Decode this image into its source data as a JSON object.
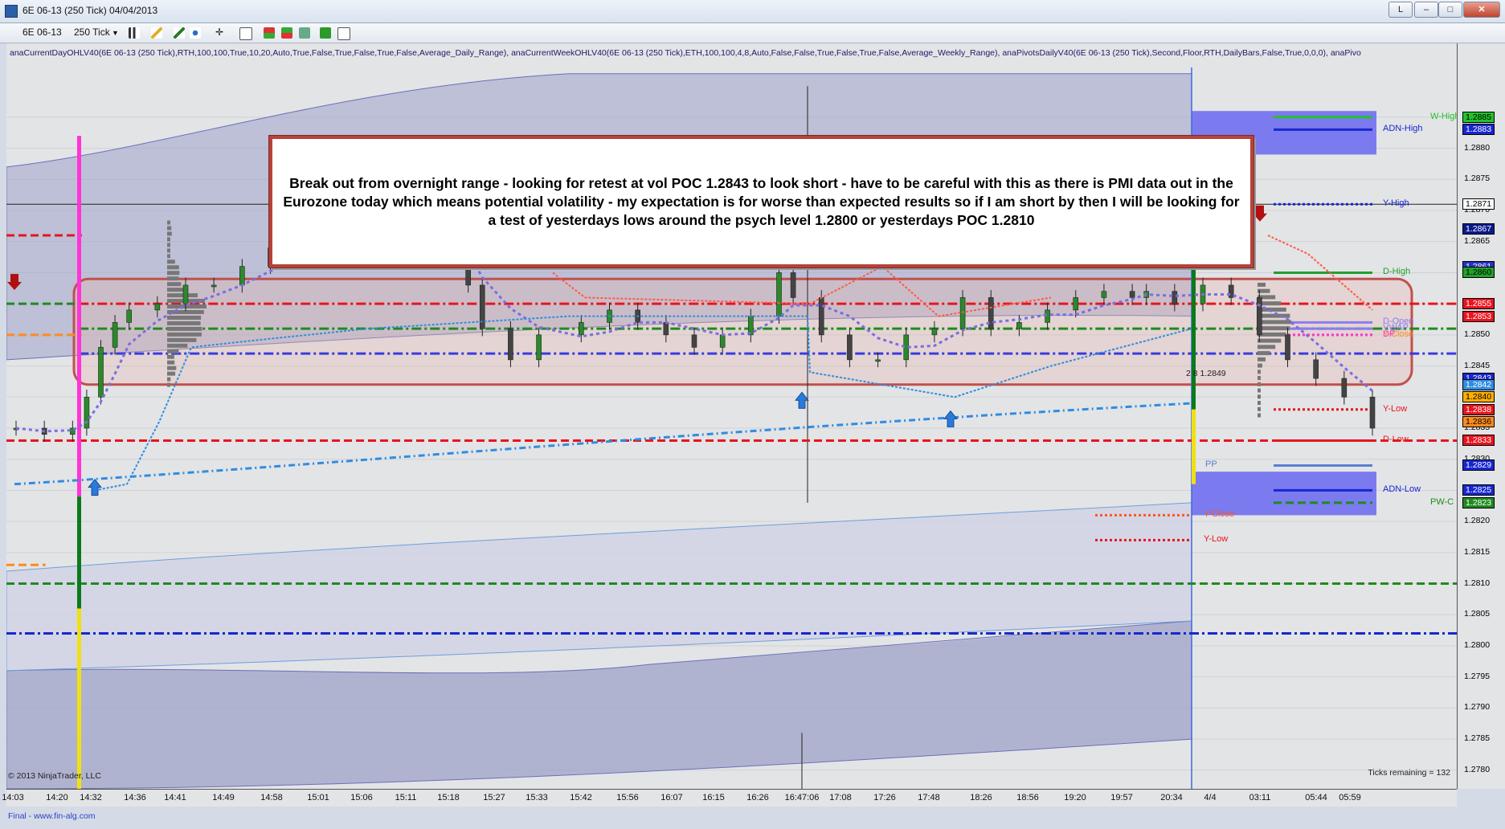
{
  "window": {
    "title": "6E 06-13 (250 Tick)  04/04/2013",
    "buttons": [
      "L",
      "–",
      "□",
      "✕"
    ]
  },
  "toolbar": {
    "instrument": "6E 06-13",
    "period": "250 Tick"
  },
  "indicators_line": "anaCurrentDayOHLV40(6E 06-13 (250 Tick),RTH,100,100,True,10,20,Auto,True,False,True,False,True,False,Average_Daily_Range), anaCurrentWeekOHLV40(6E 06-13 (250 Tick),ETH,100,100,4,8,Auto,False,False,True,False,True,False,Average_Weekly_Range), anaPivotsDailyV40(6E 06-13 (250 Tick),Second,Floor,RTH,DailyBars,False,True,0,0,0), anaPivo",
  "annotation": {
    "text": "Break out from overnight range - looking for retest at vol POC 1.2843 to look short - have to be careful with this as there is PMI data out in the Eurozone today which means potential volatility - my expectation is for worse than expected results so if I am short by then I will be looking for a test of yesterdays lows around the psych level 1.2800 or yesterdays POC 1.2810"
  },
  "copyright": "© 2013 NinjaTrader, LLC",
  "ticks_remaining": "Ticks remaining = 132",
  "footer_note": "Final - www.fin-alg.com",
  "mid_label": "2 8 1.2849",
  "colors": {
    "chart_bg": "#e3e4e6",
    "band": "#9fa3c8",
    "red": "#e8141e",
    "green": "#1f8a1f",
    "blue": "#1727d0",
    "orange": "#ff8a1e",
    "magenta": "#ff33d6",
    "lightblue": "#2f8de0",
    "purple": "#7a6ee0"
  },
  "chart_data": {
    "type": "line",
    "title": "6E 06-13 (250 Tick)",
    "ylim": [
      1.2777,
      1.2893
    ],
    "y_ticks": [
      "1.2885",
      "1.2880",
      "1.2875",
      "1.2870",
      "1.2865",
      "1.2860",
      "1.2855",
      "1.2850",
      "1.2845",
      "1.2840",
      "1.2835",
      "1.2830",
      "1.2825",
      "1.2820",
      "1.2815",
      "1.2810",
      "1.2805",
      "1.2800",
      "1.2795",
      "1.2790",
      "1.2785",
      "1.2780"
    ],
    "x_ticks": [
      "14:03",
      "14:20",
      "14:32",
      "14:36",
      "14:41",
      "14:49",
      "14:58",
      "15:01",
      "15:06",
      "15:11",
      "15:18",
      "15:27",
      "15:33",
      "15:42",
      "15:56",
      "16:07",
      "16:15",
      "16:26",
      "16:47:06",
      "17:08",
      "17:26",
      "17:48",
      "18:26",
      "18:56",
      "19:20",
      "19:57",
      "20:34",
      "4/4",
      "03:11",
      "05:44",
      "05:59"
    ],
    "price_boxes": [
      {
        "value": "1.2885",
        "bg": "#22c22c",
        "fg": "#000"
      },
      {
        "value": "1.2883",
        "bg": "#1727d0",
        "fg": "#fff"
      },
      {
        "value": "1.2871",
        "bg": "#ffffff",
        "fg": "#000"
      },
      {
        "value": "1.2867",
        "bg": "#0a1a8a",
        "fg": "#fff"
      },
      {
        "value": "1.2861",
        "bg": "#2730c8",
        "fg": "#fff"
      },
      {
        "value": "1.2860",
        "bg": "#22a02c",
        "fg": "#000"
      },
      {
        "value": "1.2855",
        "bg": "#e8141e",
        "fg": "#fff"
      },
      {
        "value": "1.2853",
        "bg": "#e8141e",
        "fg": "#fff"
      },
      {
        "value": "1.2843",
        "bg": "#1727d0",
        "fg": "#fff"
      },
      {
        "value": "1.2842",
        "bg": "#2f8de0",
        "fg": "#fff"
      },
      {
        "value": "1.2840",
        "bg": "#ffb000",
        "fg": "#000"
      },
      {
        "value": "1.2838",
        "bg": "#e8141e",
        "fg": "#fff"
      },
      {
        "value": "1.2836",
        "bg": "#ff8a1e",
        "fg": "#000"
      },
      {
        "value": "1.2833",
        "bg": "#e8141e",
        "fg": "#fff"
      },
      {
        "value": "1.2829",
        "bg": "#1727d0",
        "fg": "#fff"
      },
      {
        "value": "1.2825",
        "bg": "#1727d0",
        "fg": "#fff"
      },
      {
        "value": "1.2823",
        "bg": "#1f8a1f",
        "fg": "#fff"
      }
    ],
    "levels": [
      {
        "name": "W-High",
        "price": 1.2885,
        "color": "#22c22c",
        "style": "solid"
      },
      {
        "name": "ADN-High",
        "price": 1.2883,
        "color": "#1727d0",
        "style": "solid"
      },
      {
        "name": "Y-High",
        "price": 1.2871,
        "color": "#1727d0",
        "style": "dotted"
      },
      {
        "name": "D-High",
        "price": 1.286,
        "color": "#22a02c",
        "style": "solid"
      },
      {
        "name": "D-Open",
        "price": 1.2852,
        "color": "#8b7cf0",
        "style": "solid"
      },
      {
        "name": "VWAP",
        "price": 1.2851,
        "color": "#8b7cf0",
        "style": "solid"
      },
      {
        "name": "Y-Close",
        "price": 1.285,
        "color": "#ff8a1e",
        "style": "dotted"
      },
      {
        "name": "DP",
        "price": 1.285,
        "color": "#ff33d6",
        "style": "dotted"
      },
      {
        "name": "Y-Low",
        "price": 1.2838,
        "color": "#e8141e",
        "style": "dotted"
      },
      {
        "name": "D-Low",
        "price": 1.2833,
        "color": "#e8141e",
        "style": "solid"
      },
      {
        "name": "PP",
        "price": 1.2829,
        "color": "#5a7fd0",
        "style": "solid"
      },
      {
        "name": "ADN-Low",
        "price": 1.2825,
        "color": "#1727d0",
        "style": "solid"
      },
      {
        "name": "PW-C",
        "price": 1.2823,
        "color": "#1f8a1f",
        "style": "dashed"
      },
      {
        "name": "Y-Close",
        "price": 1.2821,
        "color": "#ff5522",
        "style": "dotted"
      },
      {
        "name": "Y-Low",
        "price": 1.2817,
        "color": "#e8141e",
        "style": "dotted"
      }
    ],
    "horizontal_lines": [
      {
        "price": 1.2866,
        "color": "#e8141e",
        "style": "dashed",
        "x0": 0,
        "x1": 0.052
      },
      {
        "price": 1.2855,
        "color": "#1f8a1f",
        "style": "dashed",
        "x0": 0,
        "x1": 0.052
      },
      {
        "price": 1.285,
        "color": "#ff8a1e",
        "style": "dashed",
        "x0": 0,
        "x1": 0.052
      },
      {
        "price": 1.2833,
        "color": "#e8141e",
        "style": "dashed",
        "x0": 0,
        "x1": 1
      },
      {
        "price": 1.2813,
        "color": "#ff8a1e",
        "style": "dashed",
        "x0": 0,
        "x1": 0.027
      },
      {
        "price": 1.281,
        "color": "#1f8a1f",
        "style": "dashed",
        "x0": 0,
        "x1": 1
      },
      {
        "price": 1.2802,
        "color": "#1727d0",
        "style": "dashdot",
        "x0": 0,
        "x1": 1
      },
      {
        "price": 1.2855,
        "color": "#e8141e",
        "style": "dashdot",
        "x0": 0.05,
        "x1": 1
      },
      {
        "price": 1.2851,
        "color": "#1f8a1f",
        "style": "dashdot",
        "x0": 0.05,
        "x1": 1
      },
      {
        "price": 1.2847,
        "color": "#3a3ae0",
        "style": "dashdot",
        "x0": 0.05,
        "x1": 1
      }
    ],
    "price_series": [
      {
        "t": 0,
        "p": 1.2835
      },
      {
        "t": 2,
        "p": 1.2834
      },
      {
        "t": 4,
        "p": 1.2835
      },
      {
        "t": 5,
        "p": 1.284
      },
      {
        "t": 6,
        "p": 1.2848
      },
      {
        "t": 7,
        "p": 1.2852
      },
      {
        "t": 8,
        "p": 1.2854
      },
      {
        "t": 10,
        "p": 1.2855
      },
      {
        "t": 12,
        "p": 1.2858
      },
      {
        "t": 14,
        "p": 1.2858
      },
      {
        "t": 16,
        "p": 1.2861
      },
      {
        "t": 18,
        "p": 1.2864
      },
      {
        "t": 20,
        "p": 1.2866
      },
      {
        "t": 22,
        "p": 1.2867
      },
      {
        "t": 24,
        "p": 1.2866
      },
      {
        "t": 26,
        "p": 1.2867
      },
      {
        "t": 28,
        "p": 1.2866
      },
      {
        "t": 30,
        "p": 1.2862
      },
      {
        "t": 32,
        "p": 1.2858
      },
      {
        "t": 33,
        "p": 1.2851
      },
      {
        "t": 35,
        "p": 1.2846
      },
      {
        "t": 37,
        "p": 1.285
      },
      {
        "t": 40,
        "p": 1.2852
      },
      {
        "t": 42,
        "p": 1.2854
      },
      {
        "t": 44,
        "p": 1.2852
      },
      {
        "t": 46,
        "p": 1.285
      },
      {
        "t": 48,
        "p": 1.2848
      },
      {
        "t": 50,
        "p": 1.285
      },
      {
        "t": 52,
        "p": 1.2853
      },
      {
        "t": 54,
        "p": 1.286
      },
      {
        "t": 55,
        "p": 1.2856
      },
      {
        "t": 57,
        "p": 1.285
      },
      {
        "t": 59,
        "p": 1.2846
      },
      {
        "t": 61,
        "p": 1.2846
      },
      {
        "t": 63,
        "p": 1.285
      },
      {
        "t": 65,
        "p": 1.2851
      },
      {
        "t": 67,
        "p": 1.2856
      },
      {
        "t": 69,
        "p": 1.2851
      },
      {
        "t": 71,
        "p": 1.2852
      },
      {
        "t": 73,
        "p": 1.2854
      },
      {
        "t": 75,
        "p": 1.2856
      },
      {
        "t": 77,
        "p": 1.2857
      },
      {
        "t": 79,
        "p": 1.2856
      },
      {
        "t": 80,
        "p": 1.2857
      },
      {
        "t": 82,
        "p": 1.2855
      },
      {
        "t": 84,
        "p": 1.2858
      },
      {
        "t": 86,
        "p": 1.2856
      },
      {
        "t": 88,
        "p": 1.285
      },
      {
        "t": 90,
        "p": 1.2846
      },
      {
        "t": 92,
        "p": 1.2843
      },
      {
        "t": 94,
        "p": 1.284
      },
      {
        "t": 96,
        "p": 1.2835
      }
    ]
  }
}
